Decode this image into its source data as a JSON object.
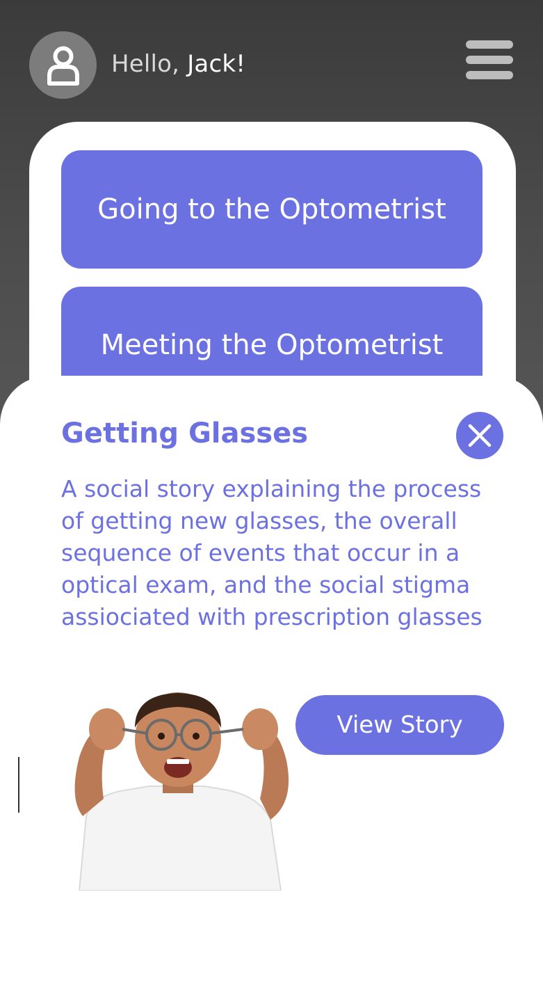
{
  "header": {
    "greeting_prefix": "Hello,",
    "user_name": "Jack!",
    "avatar_icon": "user-icon",
    "menu_icon": "hamburger-menu-icon"
  },
  "topics": [
    {
      "label": "Going to the Optometrist"
    },
    {
      "label": "Meeting the Optometrist"
    }
  ],
  "detail": {
    "title": "Getting Glasses",
    "description": "A social story explaining the process of getting new glasses, the overall sequence of events that occur in a optical exam, and the social stigma assiociated with prescription glasses",
    "close_icon": "close-icon",
    "view_button_label": "View Story",
    "image_alt": "Boy adjusting his glasses"
  },
  "colors": {
    "accent": "#6c71e1",
    "header_bg": "#424242",
    "surface": "#ffffff"
  }
}
